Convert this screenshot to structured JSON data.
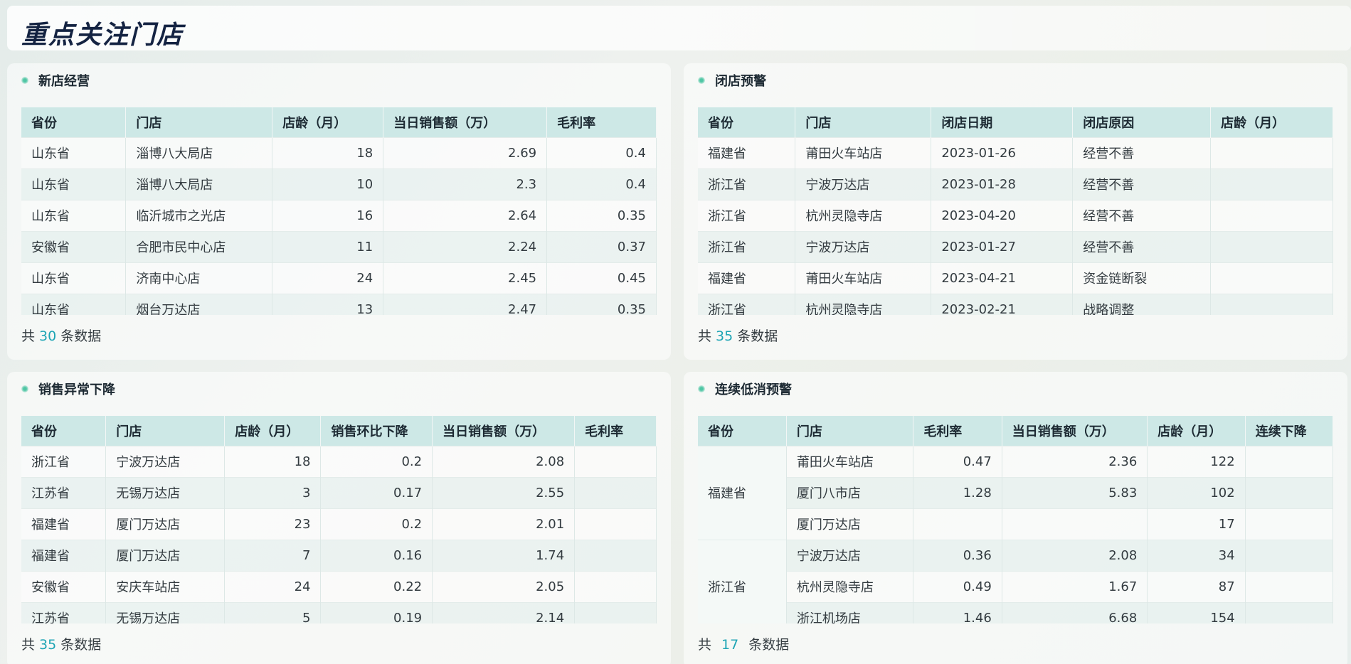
{
  "page_title": "重点关注门店",
  "footer_prefix": "共",
  "footer_suffix": "条数据",
  "panels": {
    "new_store": {
      "title": "新店经营",
      "headers": [
        "省份",
        "门店",
        "店龄（月）",
        "当日销售额（万）",
        "毛利率"
      ],
      "rows": [
        [
          "山东省",
          "淄博八大局店",
          "18",
          "2.69",
          "0.4"
        ],
        [
          "山东省",
          "淄博八大局店",
          "10",
          "2.3",
          "0.4"
        ],
        [
          "山东省",
          "临沂城市之光店",
          "16",
          "2.64",
          "0.35"
        ],
        [
          "安徽省",
          "合肥市民中心店",
          "11",
          "2.24",
          "0.37"
        ],
        [
          "山东省",
          "济南中心店",
          "24",
          "2.45",
          "0.45"
        ],
        [
          "山东省",
          "烟台万达店",
          "13",
          "2.47",
          "0.35"
        ]
      ],
      "count": "30"
    },
    "closing": {
      "title": "闭店预警",
      "headers": [
        "省份",
        "门店",
        "闭店日期",
        "闭店原因",
        "店龄（月）"
      ],
      "rows": [
        [
          "福建省",
          "莆田火车站店",
          "2023-01-26",
          "经营不善",
          ""
        ],
        [
          "浙江省",
          "宁波万达店",
          "2023-01-28",
          "经营不善",
          ""
        ],
        [
          "浙江省",
          "杭州灵隐寺店",
          "2023-04-20",
          "经营不善",
          ""
        ],
        [
          "浙江省",
          "宁波万达店",
          "2023-01-27",
          "经营不善",
          ""
        ],
        [
          "福建省",
          "莆田火车站店",
          "2023-04-21",
          "资金链断裂",
          ""
        ],
        [
          "浙江省",
          "杭州灵隐寺店",
          "2023-02-21",
          "战略调整",
          ""
        ]
      ],
      "count": "35"
    },
    "sales_drop": {
      "title": "销售异常下降",
      "headers": [
        "省份",
        "门店",
        "店龄（月）",
        "销售环比下降",
        "当日销售额（万）",
        "毛利率"
      ],
      "rows": [
        [
          "浙江省",
          "宁波万达店",
          "18",
          "0.2",
          "2.08",
          ""
        ],
        [
          "江苏省",
          "无锡万达店",
          "3",
          "0.17",
          "2.55",
          ""
        ],
        [
          "福建省",
          "厦门万达店",
          "23",
          "0.2",
          "2.01",
          ""
        ],
        [
          "福建省",
          "厦门万达店",
          "7",
          "0.16",
          "1.74",
          ""
        ],
        [
          "安徽省",
          "安庆车站店",
          "24",
          "0.22",
          "2.05",
          ""
        ],
        [
          "江苏省",
          "无锡万达店",
          "5",
          "0.19",
          "2.14",
          ""
        ]
      ],
      "count": "35"
    },
    "low_consume": {
      "title": "连续低消预警",
      "headers": [
        "省份",
        "门店",
        "毛利率",
        "当日销售额（万）",
        "店龄（月）",
        "连续下降"
      ],
      "groups": [
        {
          "province": "福建省",
          "rows": [
            [
              "莆田火车站店",
              "0.47",
              "2.36",
              "122",
              ""
            ],
            [
              "厦门八市店",
              "1.28",
              "5.83",
              "102",
              ""
            ],
            [
              "厦门万达店",
              "",
              "",
              "17",
              ""
            ]
          ]
        },
        {
          "province": "浙江省",
          "rows": [
            [
              "宁波万达店",
              "0.36",
              "2.08",
              "34",
              ""
            ],
            [
              "杭州灵隐寺店",
              "0.49",
              "1.67",
              "87",
              ""
            ],
            [
              "浙江机场店",
              "1.46",
              "6.68",
              "154",
              ""
            ]
          ]
        }
      ],
      "count": "17"
    }
  }
}
